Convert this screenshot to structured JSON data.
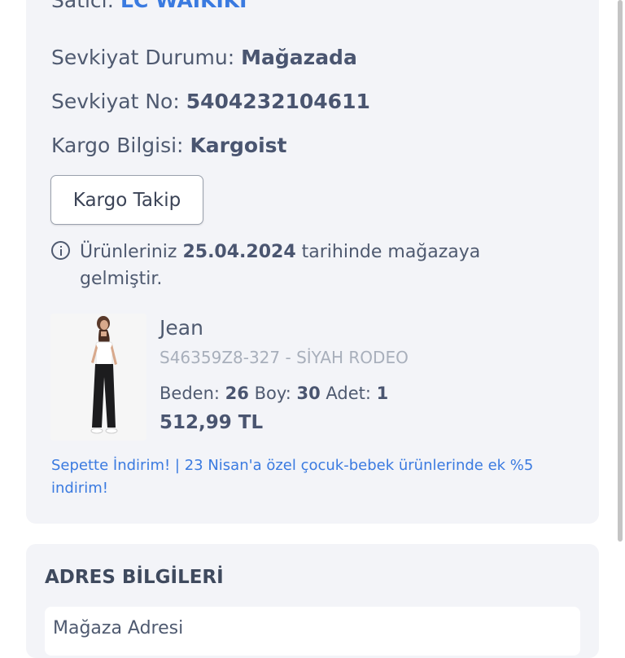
{
  "shipment": {
    "seller_label": "Satıcı:",
    "seller_name": "LC WAIKIKI",
    "status_label": "Sevkiyat Durumu:",
    "status_value": "Mağazada",
    "number_label": "Sevkiyat No:",
    "number_value": "5404232104611",
    "cargo_label": "Kargo Bilgisi:",
    "cargo_value": "Kargoist",
    "track_button": "Kargo Takip",
    "info_prefix": "Ürünleriniz",
    "info_date": "25.04.2024",
    "info_suffix": "tarihinde mağazaya gelmiştir."
  },
  "product": {
    "name": "Jean",
    "code": "S46359Z8-327 - SİYAH RODEO",
    "size_label": "Beden:",
    "size_value": "26",
    "length_label": "Boy:",
    "length_value": "30",
    "qty_label": "Adet:",
    "qty_value": "1",
    "price": "512,99 TL",
    "promo": "Sepette İndirim! | 23 Nisan'a özel çocuk-bebek ürünlerinde ek %5 indirim!"
  },
  "address": {
    "title": "ADRES BİLGİLERİ",
    "first_line": "Mağaza Adresi"
  },
  "colors": {
    "card_bg": "#f3f4f8",
    "link_blue": "#3a7ae0",
    "text": "#4f5a70",
    "muted": "#a8afbb"
  }
}
